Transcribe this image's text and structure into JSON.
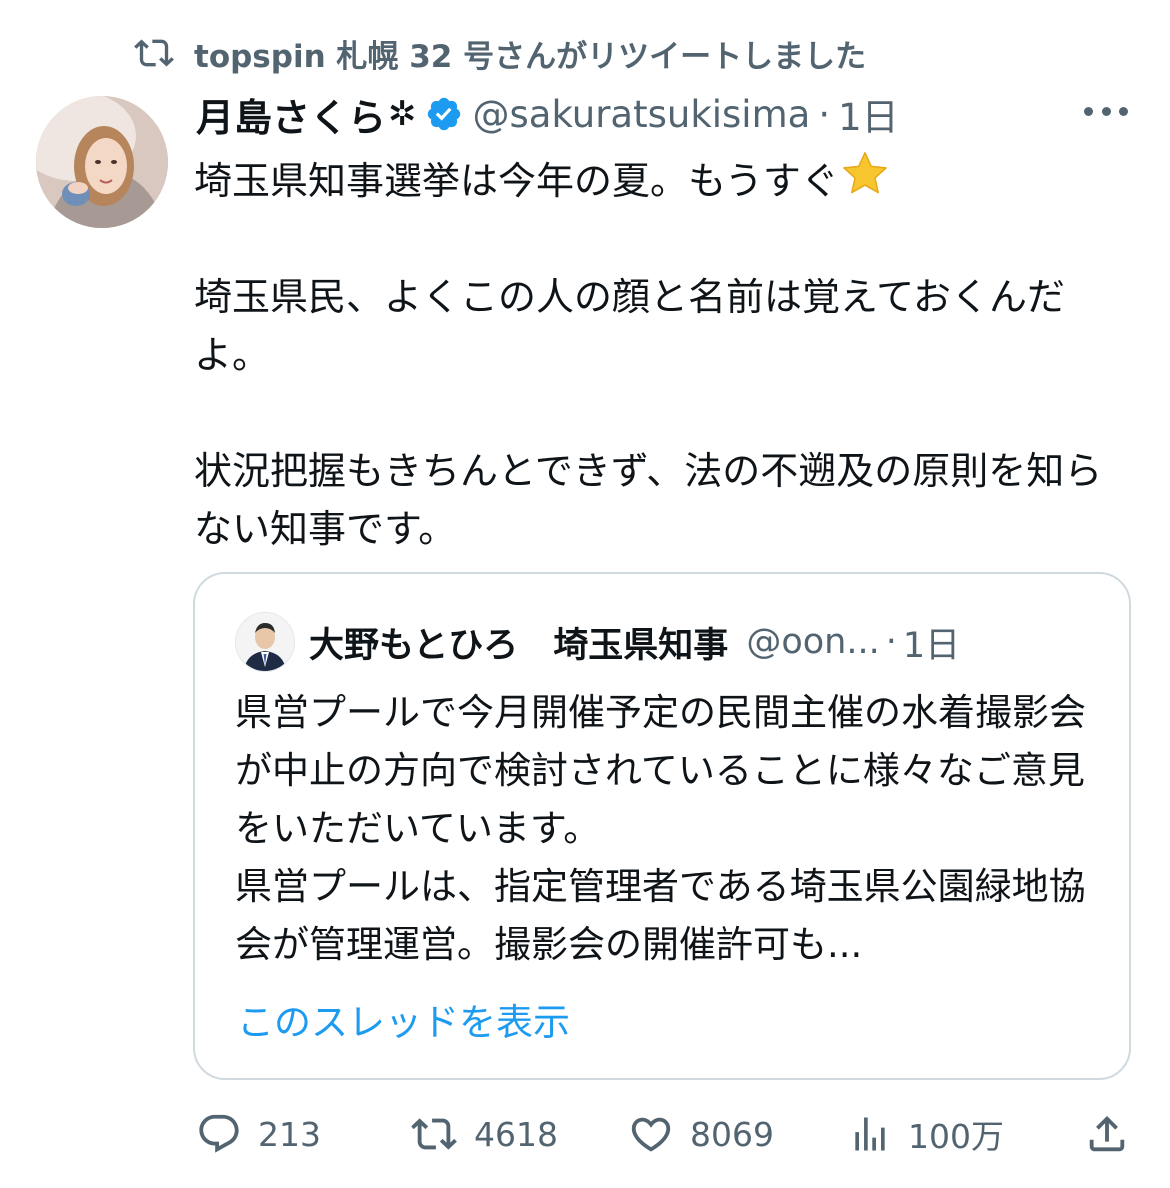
{
  "retweet_banner": "topspin 札幌 32 号さんがリツイートしました",
  "author": {
    "display_name": "月島さくら",
    "name_suffix": "✲",
    "handle": "@sakuratsukisima",
    "separator": "·",
    "time": "1日",
    "verified": true
  },
  "tweet": {
    "text": "埼玉県知事選挙は今年の夏。もうすぐ",
    "text_emoji": "star-emoji",
    "text_rest": "\n\n埼玉県民、よくこの人の顔と名前は覚えておくんだよ。\n\n状況把握もきちんとできず、法の不遡及の原則を知らない知事です。"
  },
  "quote": {
    "display_name": "大野もとひろ　埼玉県知事",
    "handle": "@oon...",
    "separator": "·",
    "time": "1日",
    "text": "県営プールで今月開催予定の民間主催の水着撮影会が中止の方向で検討されていることに様々なご意見をいただいています。\n県営プールは、指定管理者である埼玉県公園緑地協会が管理運営。撮影会の開催許可も...",
    "show_thread": "このスレッドを表示"
  },
  "metrics": {
    "replies": "213",
    "retweets": "4618",
    "likes": "8069",
    "views": "100万"
  },
  "colors": {
    "text": "#0f1419",
    "secondary": "#536471",
    "link": "#1d9bf0",
    "border": "#cfd9de",
    "verified": "#1d9bf0"
  }
}
